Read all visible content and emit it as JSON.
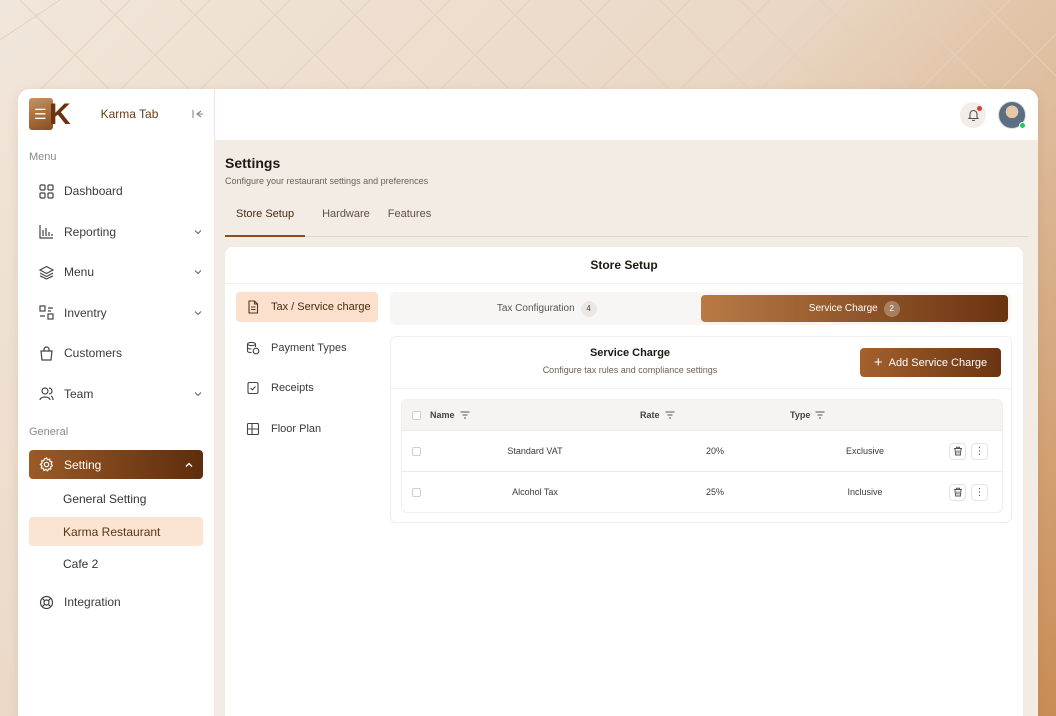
{
  "app": {
    "brand": "Karma Tab"
  },
  "sidebar": {
    "menu_label": "Menu",
    "general_label": "General",
    "items": [
      {
        "label": "Dashboard",
        "icon": "grid-icon"
      },
      {
        "label": "Reporting",
        "icon": "bar-chart-icon"
      },
      {
        "label": "Menu",
        "icon": "layers-icon"
      },
      {
        "label": "Inventry",
        "icon": "inventory-icon"
      },
      {
        "label": "Customers",
        "icon": "bag-icon"
      },
      {
        "label": "Team",
        "icon": "users-icon"
      }
    ],
    "setting": {
      "label": "Setting",
      "icon": "gear-icon"
    },
    "sub_items": [
      "General Setting",
      "Karma Restaurant",
      "Cafe 2"
    ],
    "integration": {
      "label": "Integration",
      "icon": "lifebuoy-icon"
    }
  },
  "page": {
    "title": "Settings",
    "subtitle": "Configure your restaurant settings and preferences",
    "tabs": [
      "Store Setup",
      "Hardware",
      "Features"
    ]
  },
  "card": {
    "title": "Store Setup",
    "subnav": [
      "Tax / Service charge",
      "Payment Types",
      "Receipts",
      "Floor Plan"
    ],
    "segments": [
      {
        "label": "Tax Configuration",
        "count": "4"
      },
      {
        "label": "Service Charge",
        "count": "2"
      }
    ]
  },
  "panel": {
    "title": "Service Charge",
    "subtitle": "Configure tax rules and compliance settings",
    "add_label": "Add Service Charge",
    "columns": [
      "Name",
      "Rate",
      "Type"
    ],
    "rows": [
      {
        "name": "Standard VAT",
        "rate": "20%",
        "type": "Exclusive"
      },
      {
        "name": "Alcohol Tax",
        "rate": "25%",
        "type": "Inclusive"
      }
    ]
  },
  "colors": {
    "accent": "#8a4d1e",
    "accent_dark": "#5e2d0c",
    "selection": "#fbe1cd"
  }
}
